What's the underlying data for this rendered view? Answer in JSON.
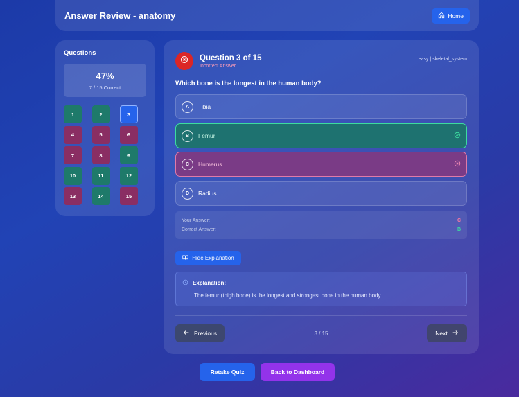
{
  "header": {
    "title": "Answer Review - anatomy",
    "home_label": "Home"
  },
  "sidebar": {
    "title": "Questions",
    "score_percent": "47%",
    "score_summary": "7 / 15 Correct",
    "questions": [
      {
        "label": "1",
        "state": "correct"
      },
      {
        "label": "2",
        "state": "correct"
      },
      {
        "label": "3",
        "state": "current"
      },
      {
        "label": "4",
        "state": "incorrect"
      },
      {
        "label": "5",
        "state": "incorrect"
      },
      {
        "label": "6",
        "state": "incorrect"
      },
      {
        "label": "7",
        "state": "incorrect"
      },
      {
        "label": "8",
        "state": "incorrect"
      },
      {
        "label": "9",
        "state": "correct"
      },
      {
        "label": "10",
        "state": "correct"
      },
      {
        "label": "11",
        "state": "correct"
      },
      {
        "label": "12",
        "state": "correct"
      },
      {
        "label": "13",
        "state": "incorrect"
      },
      {
        "label": "14",
        "state": "correct"
      },
      {
        "label": "15",
        "state": "incorrect"
      }
    ]
  },
  "question": {
    "number_label": "Question 3 of 15",
    "status": "Incorrect Answer",
    "meta": "easy | skeletal_system",
    "text": "Which bone is the longest in the human body?",
    "options": [
      {
        "letter": "A",
        "text": "Tibia",
        "state": "neutral"
      },
      {
        "letter": "B",
        "text": "Femur",
        "state": "correct"
      },
      {
        "letter": "C",
        "text": "Humerus",
        "state": "incorrect"
      },
      {
        "letter": "D",
        "text": "Radius",
        "state": "neutral"
      }
    ],
    "your_answer_label": "Your Answer:",
    "your_answer": "C",
    "correct_answer_label": "Correct Answer:",
    "correct_answer": "B",
    "hide_explanation_label": "Hide Explanation",
    "explanation_title": "Explanation:",
    "explanation_text": "The femur (thigh bone) is the longest and strongest bone in the human body."
  },
  "navigation": {
    "previous_label": "Previous",
    "next_label": "Next",
    "page_indicator": "3 / 15"
  },
  "footer": {
    "retake_label": "Retake Quiz",
    "dashboard_label": "Back to Dashboard"
  },
  "colors": {
    "primary": "#2563eb",
    "correct": "#3ddba0",
    "incorrect": "#dc2626",
    "accent": "#9333ea"
  }
}
